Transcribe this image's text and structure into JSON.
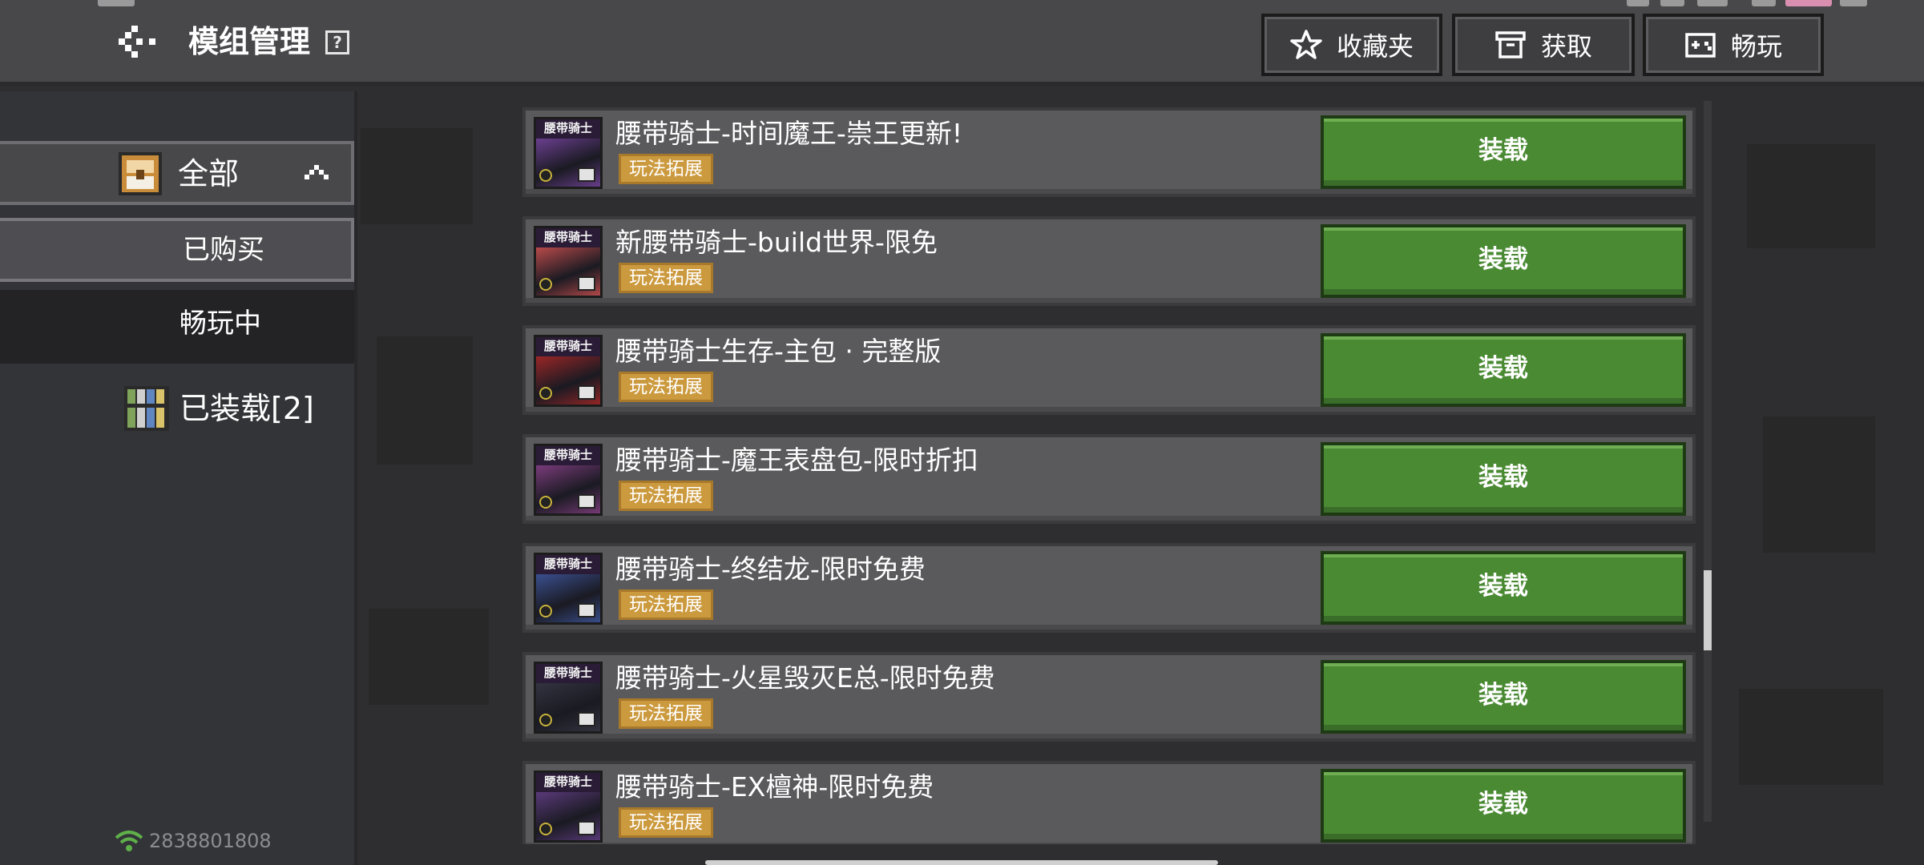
{
  "header": {
    "title": "模组管理",
    "help_label": "?",
    "buttons": [
      {
        "label": "收藏夹",
        "icon": "star-icon"
      },
      {
        "label": "获取",
        "icon": "box-icon"
      },
      {
        "label": "畅玩",
        "icon": "gamepad-icon"
      }
    ]
  },
  "sidebar": {
    "all_label": "全部",
    "bought_label": "已购买",
    "playing_label": "畅玩中",
    "installed_label": "已装载[2]",
    "net_id": "2838801808"
  },
  "mods": [
    {
      "title": "腰带骑士-时间魔王-崇王更新!",
      "tag": "玩法拓展",
      "button": "装载",
      "thumb_text": "腰带骑士",
      "thumb_color": "#6a3f8f"
    },
    {
      "title": "新腰带骑士-build世界-限免",
      "tag": "玩法拓展",
      "button": "装载",
      "thumb_text": "腰带骑士",
      "thumb_color": "#b84a4a"
    },
    {
      "title": "腰带骑士生存-主包 · 完整版",
      "tag": "玩法拓展",
      "button": "装载",
      "thumb_text": "腰带骑士",
      "thumb_color": "#9a2626"
    },
    {
      "title": "腰带骑士-魔王表盘包-限时折扣",
      "tag": "玩法拓展",
      "button": "装载",
      "thumb_text": "腰带骑士",
      "thumb_color": "#7a3b7a"
    },
    {
      "title": "腰带骑士-终结龙-限时免费",
      "tag": "玩法拓展",
      "button": "装载",
      "thumb_text": "腰带骑士",
      "thumb_color": "#3a4f8f"
    },
    {
      "title": "腰带骑士-火星毁灭E总-限时免费",
      "tag": "玩法拓展",
      "button": "装载",
      "thumb_text": "腰带骑士",
      "thumb_color": "#333340"
    },
    {
      "title": "腰带骑士-EX檀神-限时免费",
      "tag": "玩法拓展",
      "button": "装载",
      "thumb_text": "腰带骑士",
      "thumb_color": "#5a3a7a"
    }
  ],
  "colors": {
    "accent_green": "#4a8a33",
    "tag_orange": "#cc9a3e",
    "header_bg": "#48484b"
  }
}
